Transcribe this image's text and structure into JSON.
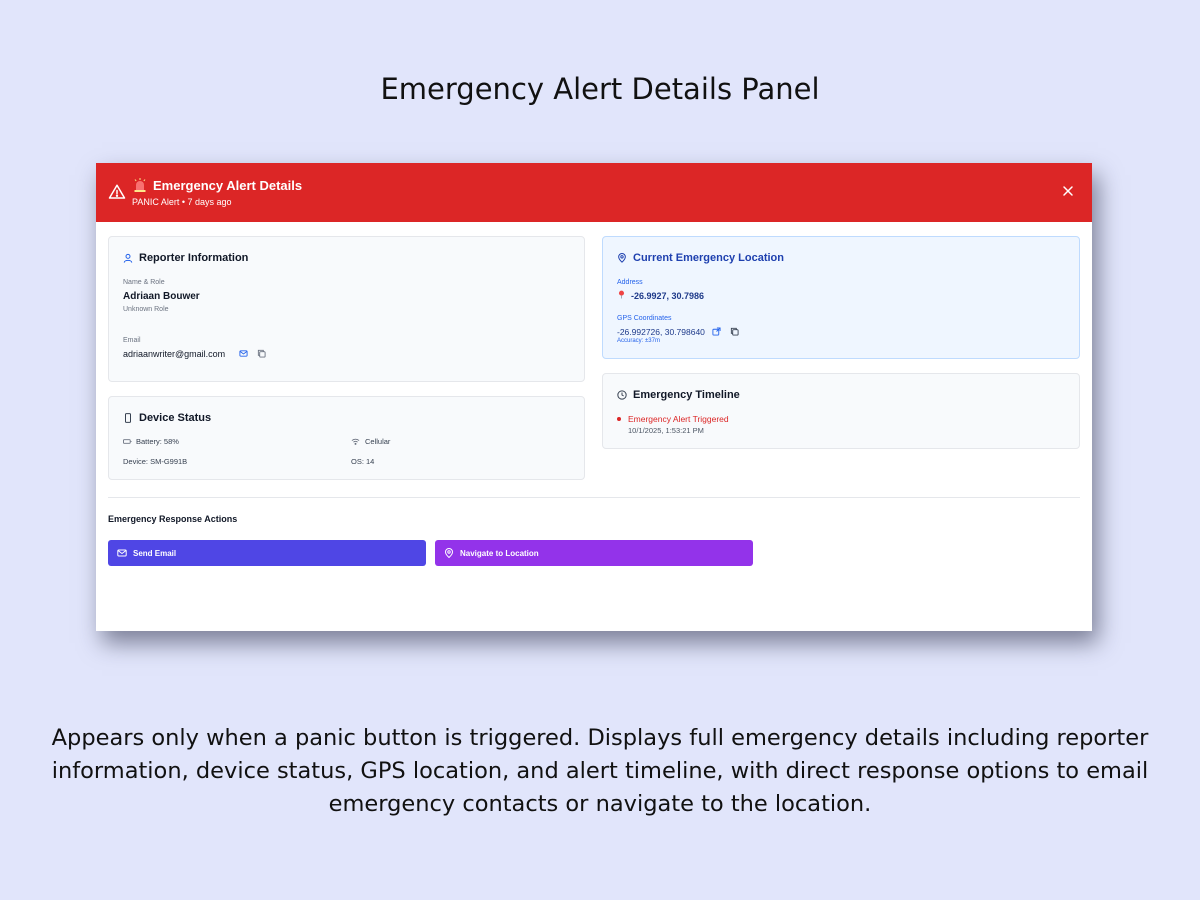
{
  "page": {
    "heading": "Emergency Alert Details Panel",
    "description": "Appears only when a panic button is triggered. Displays full emergency details including reporter information, device status, GPS location, and alert timeline, with direct response options to email emergency contacts or navigate to the location."
  },
  "modal": {
    "title": "Emergency Alert Details",
    "subtitle": "PANIC Alert • 7 days ago",
    "header_color": "#dc2626",
    "icons": {
      "alert": "warning-triangle-icon",
      "siren": "siren-icon",
      "close": "close-icon"
    }
  },
  "reporter": {
    "title": "Reporter Information",
    "name_label": "Name & Role",
    "name": "Adriaan Bouwer",
    "role": "Unknown Role",
    "email_label": "Email",
    "email": "adriaanwriter@gmail.com"
  },
  "device": {
    "title": "Device Status",
    "battery": "Battery: 58%",
    "network": "Cellular",
    "device": "Device: SM-G991B",
    "os": "OS: 14"
  },
  "location": {
    "title": "Current Emergency Location",
    "address_label": "Address",
    "address": "-26.9927, 30.7986",
    "gps_label": "GPS Coordinates",
    "gps": "-26.992726, 30.798640",
    "accuracy": "Accuracy: ±37m"
  },
  "timeline": {
    "title": "Emergency Timeline",
    "events": [
      {
        "label": "Emergency Alert Triggered",
        "time": "10/1/2025, 1:53:21 PM",
        "color": "#dc2626"
      }
    ]
  },
  "actions": {
    "title": "Emergency Response Actions",
    "email_label": "Send Email",
    "navigate_label": "Navigate to Location",
    "email_color": "#4f46e5",
    "navigate_color": "#9333ea"
  }
}
